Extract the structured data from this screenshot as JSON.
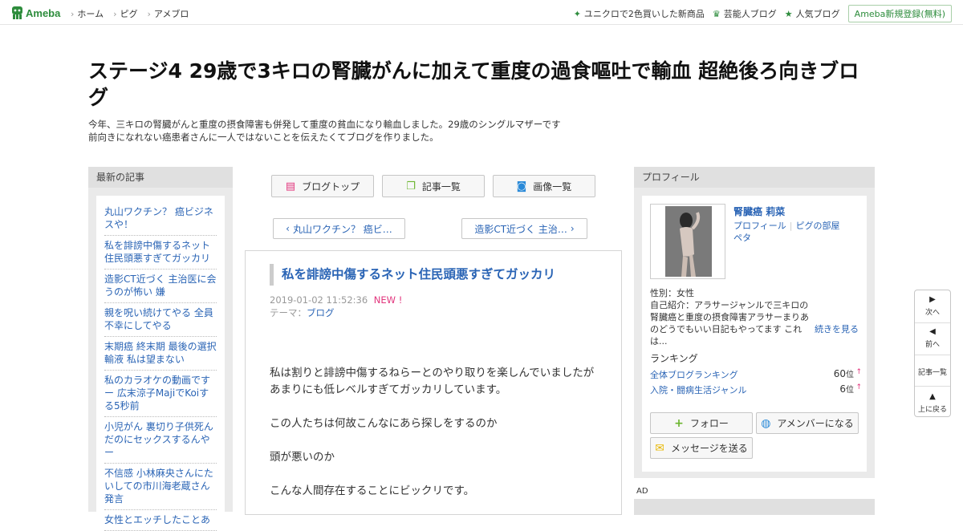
{
  "topbar": {
    "logo_text": "Ameba",
    "nav": [
      "ホーム",
      "ピグ",
      "アメブロ"
    ],
    "links": [
      {
        "icon": "sparkle-icon",
        "label": "ユニクロで2色買いした新商品"
      },
      {
        "icon": "crown-icon",
        "label": "芸能人ブログ"
      },
      {
        "icon": "star-icon",
        "label": "人気ブログ"
      }
    ],
    "register_label": "Ameba新規登録(無料)"
  },
  "header": {
    "title": "ステージ4 29歳で3キロの腎臓がんに加えて重度の過食嘔吐で輸血 超絶後ろ向きブログ",
    "desc_line1": "今年、三キロの腎臓がんと重度の摂食障害も併発して重度の貧血になり輸血しました。29歳のシングルマザーです",
    "desc_line2": "前向きになれない癌患者さんに一人ではないことを伝えたくてブログを作りました。"
  },
  "recent": {
    "heading": "最新の記事",
    "items": [
      "丸山ワクチン？ 癌ビジネスや！",
      "私を誹謗中傷するネット住民頭悪すぎてガッカリ",
      "造影CT近づく 主治医に会うのが怖い 嫌",
      "親を呪い続けてやる 全員不幸にしてやる",
      "末期癌 終末期 最後の選択 輸液 私は望まない",
      "私のカラオケの動画です ー 広末涼子MajiでKoiする5秒前",
      "小児がん 裏切り子供死んだのにセックスするんやー",
      "不信感 小林麻央さんにたいしての市川海老蔵さん発言",
      "女性とエッチしたことあ"
    ]
  },
  "toolbar": {
    "blog_top": "ブログトップ",
    "entry_list": "記事一覧",
    "image_list": "画像一覧"
  },
  "pager": {
    "prev": "丸山ワクチン？ 癌ビ…",
    "next": "造影CT近づく 主治…"
  },
  "entry": {
    "title": "私を誹謗中傷するネット住民頭悪すぎてガッカリ",
    "date": "2019-01-02 11:52:36",
    "new_label": "NEW !",
    "theme_label": "テーマ：",
    "theme": "ブログ",
    "body": [
      "私は割りと誹謗中傷するねらーとのやり取りを楽しんでいましたがあまりにも低レベルすぎてガッカリしています。",
      "この人たちは何故こんなにあら探しをするのか",
      "頭が悪いのか",
      "こんな人間存在することにビックリです。"
    ]
  },
  "profile": {
    "heading": "プロフィール",
    "name": "腎臓癌 莉菜",
    "link_profile": "プロフィール",
    "link_room": "ピグの部屋",
    "link_peta": "ペタ",
    "gender": "性別：女性",
    "intro": "自己紹介：アラサージャンルで三キロの腎臓癌と重度の摂食障害アラサーまりあのどうでもいい日記もやってます これは...",
    "more": "続きを見る",
    "ranking_heading": "ランキング",
    "rankings": [
      {
        "label": "全体ブログランキング",
        "value": "60",
        "unit": "位",
        "arrow": "↑"
      },
      {
        "label": "入院・闘病生活ジャンル",
        "value": "6",
        "unit": "位",
        "arrow": "↑"
      }
    ],
    "follow": "フォロー",
    "amember": "アメンバーになる",
    "message": "メッセージを送る"
  },
  "ad_label": "AD",
  "sidenav": {
    "next": "次へ",
    "prev": "前へ",
    "list": "記事一覧",
    "top": "上に戻る"
  },
  "colors": {
    "brand": "#2d8c3c",
    "link": "#2a64b5",
    "new": "#e2367d"
  }
}
